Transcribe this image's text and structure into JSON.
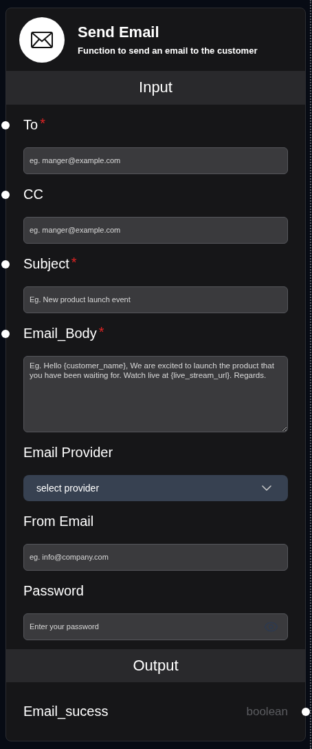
{
  "node": {
    "title": "Send Email",
    "subtitle": "Function to send an email to the customer"
  },
  "input_section": {
    "heading": "Input",
    "fields": [
      {
        "kind": "text",
        "label": "To",
        "required_mark": "*",
        "port": true,
        "placeholder": "eg. manger@example.com"
      },
      {
        "kind": "text",
        "label": "CC",
        "port": true,
        "placeholder": "eg. manger@example.com"
      },
      {
        "kind": "text",
        "label": "Subject",
        "required_mark": "*",
        "port": true,
        "placeholder": "Eg. New product launch event"
      },
      {
        "kind": "textarea",
        "label": "Email_Body",
        "required_mark": "*",
        "port": true,
        "placeholder": "Eg. Hello {customer_name}, We are excited to launch the product that you have been waiting for. Watch live at {live_stream_url}. Regards."
      },
      {
        "kind": "select",
        "label": "Email Provider",
        "port": false,
        "value": "select provider"
      },
      {
        "kind": "text",
        "label": "From Email",
        "port": false,
        "placeholder": "eg. info@company.com"
      },
      {
        "kind": "password",
        "label": "Password",
        "port": false,
        "placeholder": "Enter your password"
      }
    ]
  },
  "output_section": {
    "heading": "Output",
    "outputs": [
      {
        "label": "Email_sucess",
        "type": "boolean",
        "port": true
      }
    ]
  }
}
